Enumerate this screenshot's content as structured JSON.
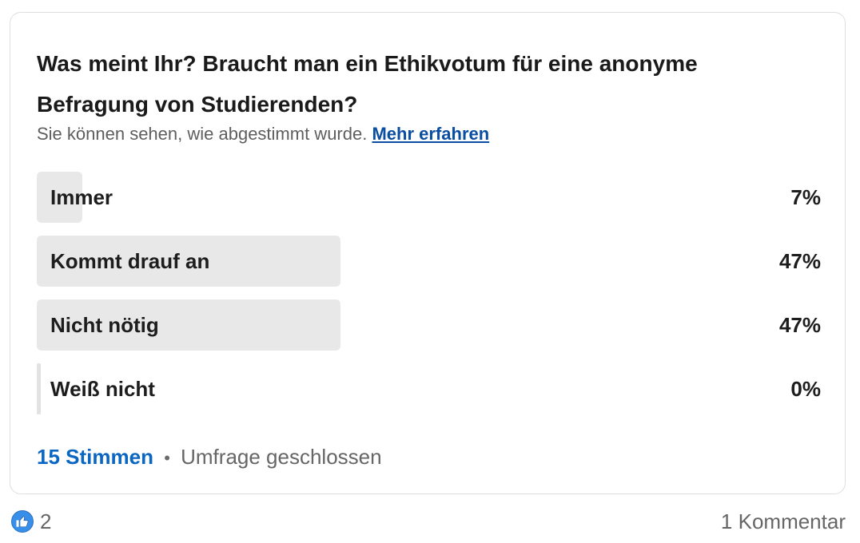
{
  "poll": {
    "question": "Was meint Ihr? Braucht man ein Ethikvotum für eine anonyme Befragung von Studierenden?",
    "visibility_text": "Sie können sehen, wie abgestimmt wurde.",
    "learn_more": "Mehr erfahren",
    "options": [
      {
        "label": "Immer",
        "percent": "7%",
        "share": 0.07
      },
      {
        "label": "Kommt drauf an",
        "percent": "47%",
        "share": 0.47
      },
      {
        "label": "Nicht nötig",
        "percent": "47%",
        "share": 0.47
      },
      {
        "label": "Weiß nicht",
        "percent": "0%",
        "share": 0.0
      }
    ],
    "votes": "15 Stimmen",
    "separator": "•",
    "status": "Umfrage geschlossen"
  },
  "social": {
    "reaction_icon": "thumbs-up-icon",
    "reaction_count": "2",
    "comments": "1 Kommentar"
  },
  "colors": {
    "accent": "#0a66c2",
    "link": "#0a4ea2",
    "bar": "#e8e8e8",
    "like_badge": "#378fe9"
  }
}
